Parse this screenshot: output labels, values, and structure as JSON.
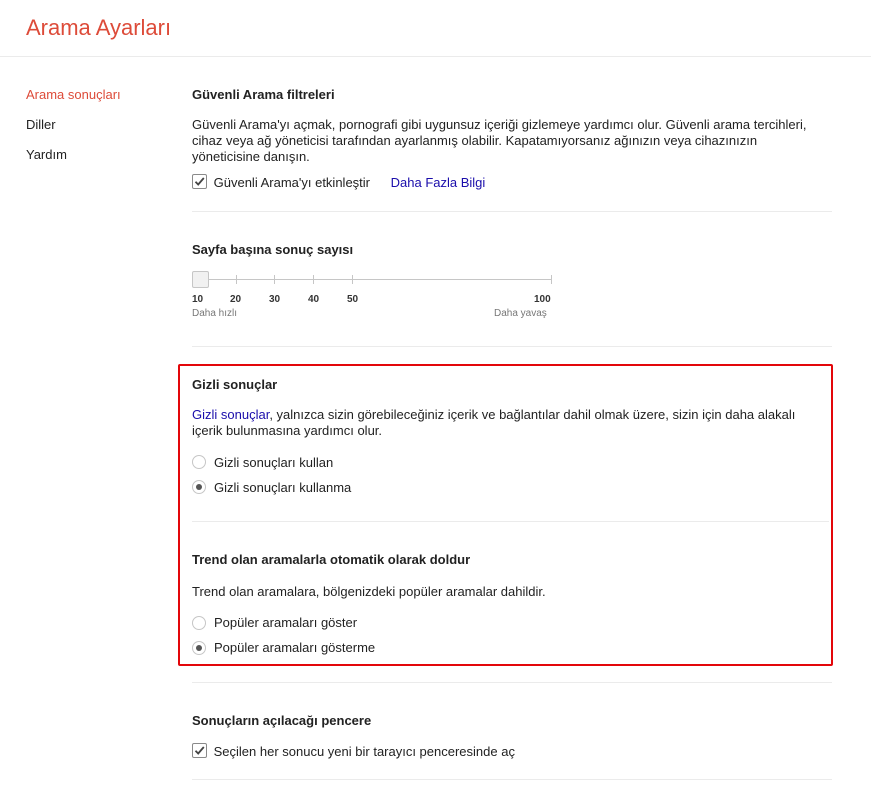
{
  "page": {
    "title": "Arama Ayarları"
  },
  "sidebar": {
    "items": [
      {
        "label": "Arama sonuçları",
        "active": true
      },
      {
        "label": "Diller"
      },
      {
        "label": "Yardım"
      }
    ]
  },
  "safe_search": {
    "heading": "Güvenli Arama filtreleri",
    "description_lines": [
      "Güvenli Arama'yı açmak, pornografi gibi uygunsuz içeriği gizlemeye yardımcı olur. Güvenli arama tercihleri,",
      "cihaz veya ağ yöneticisi tarafından ayarlanmış olabilir. Kapatamıyorsanız ağınızın veya cihazınızın",
      "yöneticisine danışın."
    ],
    "checkbox_label": "Güvenli Arama'yı etkinleştir",
    "checked": true,
    "more_link": "Daha Fazla Bilgi"
  },
  "results_per_page": {
    "heading": "Sayfa başına sonuç sayısı",
    "ticks": [
      "10",
      "20",
      "30",
      "40",
      "50",
      "100"
    ],
    "selected": "10",
    "left_caption": "Daha hızlı",
    "right_caption": "Daha yavaş"
  },
  "private_results": {
    "heading": "Gizli sonuçlar",
    "link_text": "Gizli sonuçlar",
    "description_line1": ", yalnızca sizin görebileceğiniz içerik ve bağlantılar dahil olmak üzere, sizin için daha alakalı",
    "description_line2": "içerik bulunmasına yardımcı olur.",
    "options": [
      {
        "label": "Gizli sonuçları kullan",
        "selected": false
      },
      {
        "label": "Gizli sonuçları kullanma",
        "selected": true
      }
    ]
  },
  "trending": {
    "heading": "Trend olan aramalarla otomatik olarak doldur",
    "description": "Trend olan aramalara, bölgenizdeki popüler aramalar dahildir.",
    "options": [
      {
        "label": "Popüler aramaları göster",
        "selected": false
      },
      {
        "label": "Popüler aramaları gösterme",
        "selected": true
      }
    ]
  },
  "open_window": {
    "heading": "Sonuçların açılacağı pencere",
    "checkbox_label": "Seçilen her sonucu yeni bir tarayıcı penceresinde aç",
    "checked": true
  },
  "highlight_color": "#e3060a",
  "accent_color": "#dd4b39",
  "link_color": "#1a0dab"
}
